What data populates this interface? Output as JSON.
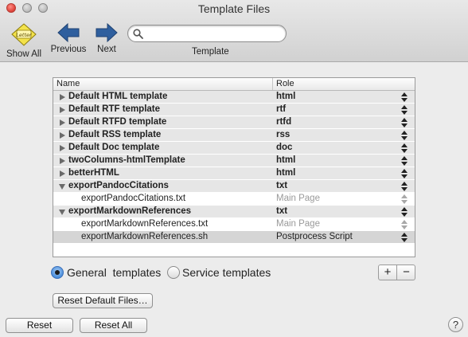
{
  "window": {
    "title": "Template Files"
  },
  "toolbar": {
    "show_all_label": "Show All",
    "show_all_icon_text": "Letter",
    "previous_label": "Previous",
    "next_label": "Next",
    "search": {
      "value": "",
      "placeholder": "",
      "label": "Template"
    }
  },
  "table": {
    "columns": {
      "name": "Name",
      "role": "Role"
    },
    "rows": [
      {
        "kind": "group",
        "expanded": false,
        "name": "Default HTML template",
        "role": "html"
      },
      {
        "kind": "group",
        "expanded": false,
        "name": "Default RTF template",
        "role": "rtf"
      },
      {
        "kind": "group",
        "expanded": false,
        "name": "Default RTFD template",
        "role": "rtfd"
      },
      {
        "kind": "group",
        "expanded": false,
        "name": "Default RSS template",
        "role": "rss"
      },
      {
        "kind": "group",
        "expanded": false,
        "name": "Default Doc template",
        "role": "doc"
      },
      {
        "kind": "group",
        "expanded": false,
        "name": "twoColumns-htmlTemplate",
        "role": "html"
      },
      {
        "kind": "group",
        "expanded": false,
        "name": "betterHTML",
        "role": "html"
      },
      {
        "kind": "group",
        "expanded": true,
        "name": "exportPandocCitations",
        "role": "txt"
      },
      {
        "kind": "sub",
        "name": "exportPandocCitations.txt",
        "role": "Main Page"
      },
      {
        "kind": "group",
        "expanded": true,
        "name": "exportMarkdownReferences",
        "role": "txt"
      },
      {
        "kind": "sub",
        "name": "exportMarkdownReferences.txt",
        "role": "Main Page"
      },
      {
        "kind": "selected",
        "name": "exportMarkdownReferences.sh",
        "role": "Postprocess Script"
      }
    ]
  },
  "options": {
    "general_label": "General  templates",
    "service_label": "Service templates",
    "selected": "general",
    "add_label": "+",
    "remove_label": "−"
  },
  "buttons": {
    "reset_defaults": "Reset Default Files…",
    "reset": "Reset",
    "reset_all": "Reset All",
    "help": "?"
  },
  "colors": {
    "arrow_blue": "#2f5f9e",
    "selected_row": "#d5d5d5",
    "group_row": "#e6e6e6"
  }
}
